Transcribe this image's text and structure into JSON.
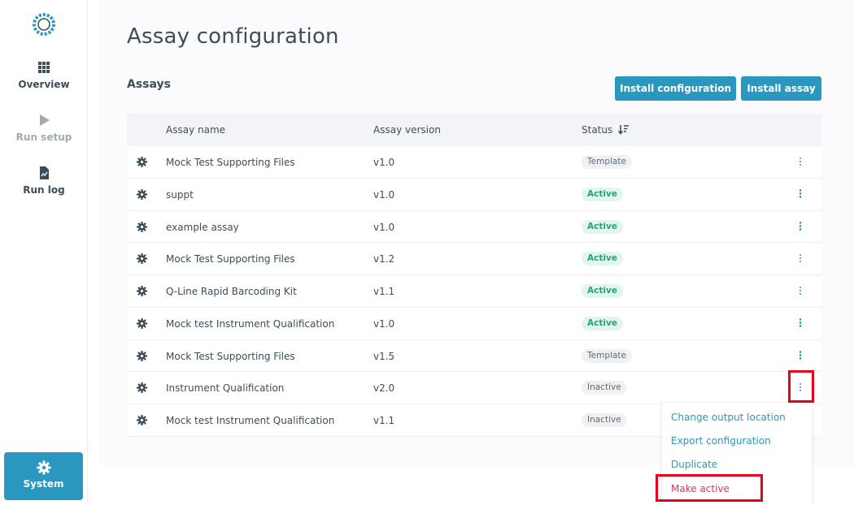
{
  "sidebar": {
    "items": [
      {
        "label": "Overview",
        "icon": "grid-icon",
        "enabled": true
      },
      {
        "label": "Run setup",
        "icon": "play-icon",
        "enabled": false
      },
      {
        "label": "Run log",
        "icon": "document-icon",
        "enabled": true
      }
    ],
    "system_label": "System"
  },
  "page": {
    "title": "Assay configuration",
    "section": "Assays",
    "install_configuration": "Install configuration",
    "install_assay": "Install assay"
  },
  "table": {
    "headers": {
      "name": "Assay name",
      "version": "Assay version",
      "status": "Status"
    },
    "rows": [
      {
        "name": "Mock Test Supporting Files",
        "version": "v1.0",
        "status": "Template"
      },
      {
        "name": "suppt",
        "version": "v1.0",
        "status": "Active"
      },
      {
        "name": "example assay",
        "version": "v1.0",
        "status": "Active"
      },
      {
        "name": "Mock Test Supporting Files",
        "version": "v1.2",
        "status": "Active"
      },
      {
        "name": "Q-Line Rapid Barcoding Kit",
        "version": "v1.1",
        "status": "Active"
      },
      {
        "name": "Mock test Instrument Qualification",
        "version": "v1.0",
        "status": "Active"
      },
      {
        "name": "Mock Test Supporting Files",
        "version": "v1.5",
        "status": "Template"
      },
      {
        "name": "Instrument Qualification",
        "version": "v2.0",
        "status": "Inactive"
      },
      {
        "name": "Mock test Instrument Qualification",
        "version": "v1.1",
        "status": "Inactive"
      }
    ]
  },
  "menu": {
    "items": [
      "Change output location",
      "Export configuration",
      "Duplicate",
      "Make active"
    ]
  },
  "colors": {
    "accent": "#2a97bf",
    "active_text": "#25a37a",
    "highlight": "#e5001c",
    "danger_text": "#e0364f"
  }
}
